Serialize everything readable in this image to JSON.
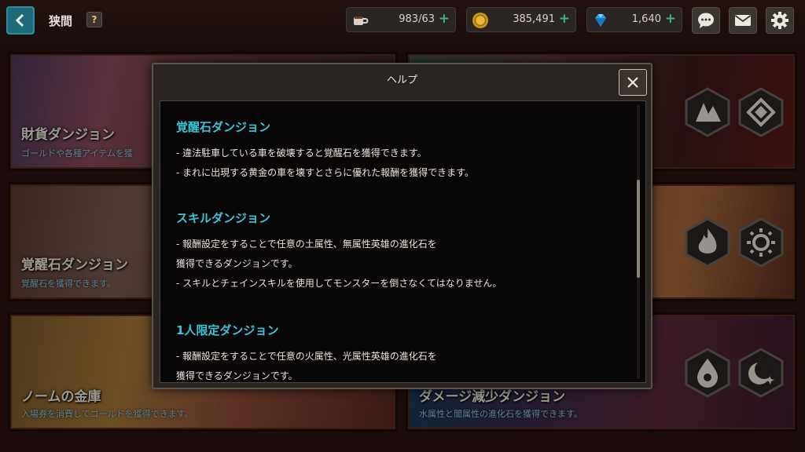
{
  "header": {
    "title": "狭間",
    "help_label": "?",
    "resources": [
      {
        "name": "stamina",
        "icon": "coffee-cup-icon",
        "value": "983/63"
      },
      {
        "name": "gold",
        "icon": "gold-coin-icon",
        "value": "385,491"
      },
      {
        "name": "gems",
        "icon": "diamond-icon",
        "value": "1,640"
      }
    ],
    "plus_label": "+"
  },
  "cards": [
    {
      "name": "財貨ダンジョン",
      "desc": "ゴールドや各種アイテムを獲"
    },
    {
      "name": "覚醒石ダンジョン",
      "desc": "覚醒石を獲得できます。"
    },
    {
      "name": "ノームの金庫",
      "desc": "入場券を消費してゴールドを獲得できます。"
    },
    {
      "name": "ダメージ減少ダンジョン",
      "desc": "水属性と闇属性の進化石を獲得できます。"
    }
  ],
  "modal": {
    "title": "ヘルプ",
    "sections": [
      {
        "title": "覚醒石ダンジョン",
        "lines": [
          "- 違法駐車している車を破壊すると覚醒石を獲得できます。",
          "- まれに出現する黄金の車を壊すとさらに優れた報酬を獲得できます。"
        ]
      },
      {
        "title": "スキルダンジョン",
        "lines": [
          "- 報酬設定をすることで任意の土属性、無属性英雄の進化石を",
          "獲得できるダンジョンです。",
          "- スキルとチェインスキルを使用してモンスターを倒さなくてはなりません。"
        ]
      },
      {
        "title": "1人限定ダンジョン",
        "lines": [
          "- 報酬設定をすることで任意の火属性、光属性英雄の進化石を",
          "獲得できるダンジョンです。"
        ]
      }
    ]
  },
  "colors": {
    "accent_cyan": "#39c6d8",
    "plus_green": "#3fae8c",
    "back_button": "#1f6a78"
  }
}
